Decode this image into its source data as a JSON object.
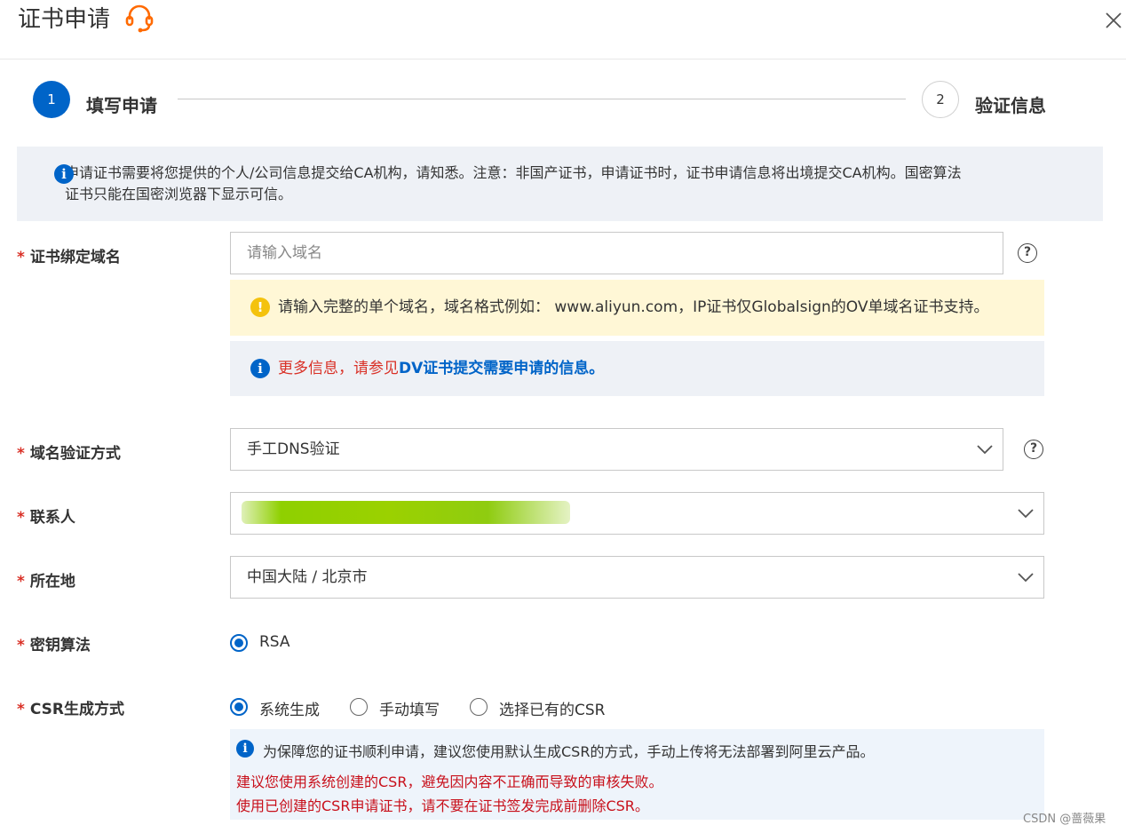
{
  "dialog": {
    "title": "证书申请",
    "icons": {
      "support": "headset-icon",
      "close": "close-icon"
    }
  },
  "steps": [
    {
      "number": "1",
      "label": "填写申请",
      "active": true
    },
    {
      "number": "2",
      "label": "验证信息",
      "active": false
    }
  ],
  "notice": {
    "icon": "info-icon",
    "line1": "申请证书需要将您提供的个人/公司信息提交给CA机构，请知悉。注意：非国产证书，申请证书时，证书申请信息将出境提交CA机构。国密算法",
    "line2": "证书只能在国密浏览器下显示可信。"
  },
  "form": {
    "required_mark": "*",
    "domain": {
      "label": "证书绑定域名",
      "placeholder": "请输入域名",
      "value": "",
      "help_icon": "help-circle-icon",
      "help_text": "?",
      "warning": "请输入完整的单个域名，域名格式例如： www.aliyun.com，IP证书仅Globalsign的OV单域名证书支持。",
      "more_prefix": "更多信息，请参见",
      "more_link": "DV证书提交需要申请的信息。"
    },
    "verify_method": {
      "label": "域名验证方式",
      "value": "手工DNS验证",
      "help_text": "?"
    },
    "contact": {
      "label": "联系人",
      "value": ""
    },
    "location": {
      "label": "所在地",
      "value": "中国大陆 / 北京市"
    },
    "key_algorithm": {
      "label": "密钥算法",
      "options": [
        {
          "label": "RSA",
          "selected": true
        }
      ]
    },
    "csr": {
      "label": "CSR生成方式",
      "options": [
        {
          "label": "系统生成",
          "selected": true
        },
        {
          "label": "手动填写",
          "selected": false
        },
        {
          "label": "选择已有的CSR",
          "selected": false
        }
      ],
      "tip": "为保障您的证书顺利申请，建议您使用默认生成CSR的方式，手动上传将无法部署到阿里云产品。",
      "warn1": "建议您使用系统创建的CSR，避免因内容不正确而导致的审核失败。",
      "warn2": "使用已创建的CSR申请证书，请不要在证书签发完成前删除CSR。"
    }
  },
  "watermark": "CSDN @蔷薇果",
  "colors": {
    "primary": "#0064c8",
    "required": "#d93026",
    "warning_bg": "#fff7d6",
    "info_bg": "#eef1f6",
    "warning_icon": "#f4c20d"
  }
}
